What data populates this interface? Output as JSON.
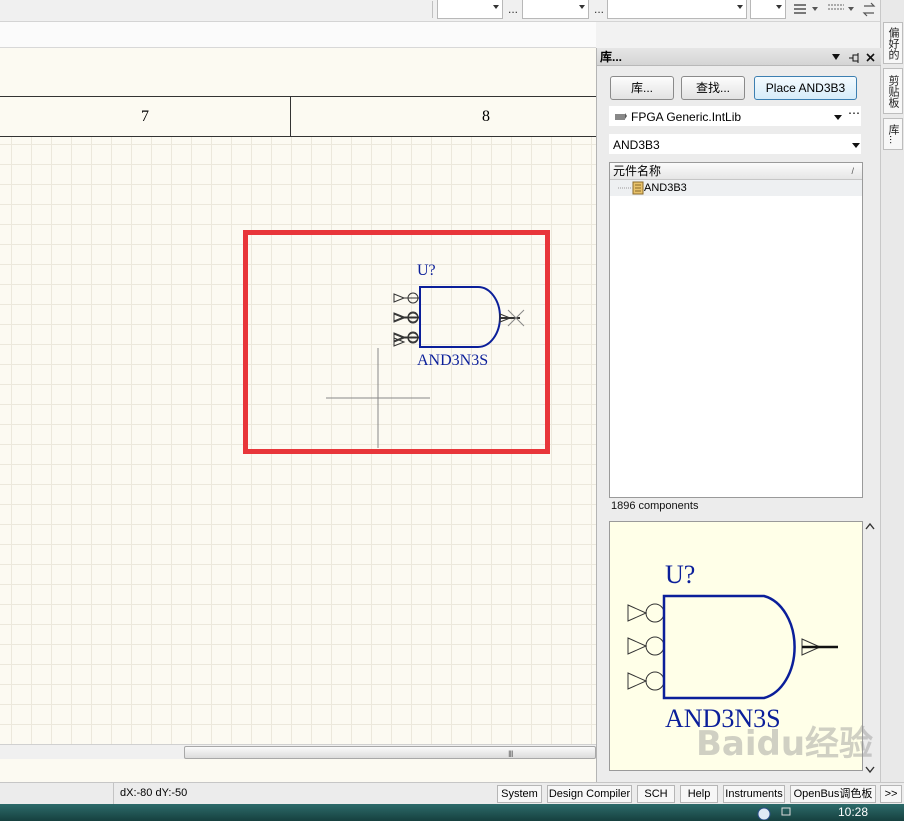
{
  "toolbar": {
    "ellipsis": "..."
  },
  "right_strip": {
    "tab1": "偏好的",
    "tab2": "剪贴板",
    "tab3": "库..."
  },
  "sheet": {
    "zones": [
      "7",
      "8"
    ],
    "component": {
      "designator": "U?",
      "name": "AND3N3S"
    }
  },
  "library": {
    "title": "库...",
    "buttons": {
      "library": "库...",
      "search": "查找...",
      "place": "Place AND3B3"
    },
    "lib_select": "FPGA Generic.IntLib",
    "filter_value": "AND3B3",
    "list_header": "元件名称",
    "items": [
      "AND3B3"
    ],
    "count": "1896 components",
    "preview": {
      "designator": "U?",
      "name": "AND3N3S"
    }
  },
  "status": {
    "coords": "dX:-80 dY:-50",
    "tabs": [
      "System",
      "Design Compiler",
      "SCH",
      "Help",
      "Instruments",
      "OpenBus调色板"
    ],
    "more": ">>"
  },
  "taskbar": {
    "clock": "10:28"
  },
  "watermark": "Baidu经验",
  "colors": {
    "highlight": "#e8363a",
    "symbol": "#0b1f9a",
    "sheet_bg": "#fcfaf2",
    "preview_bg": "#ffffe8"
  }
}
